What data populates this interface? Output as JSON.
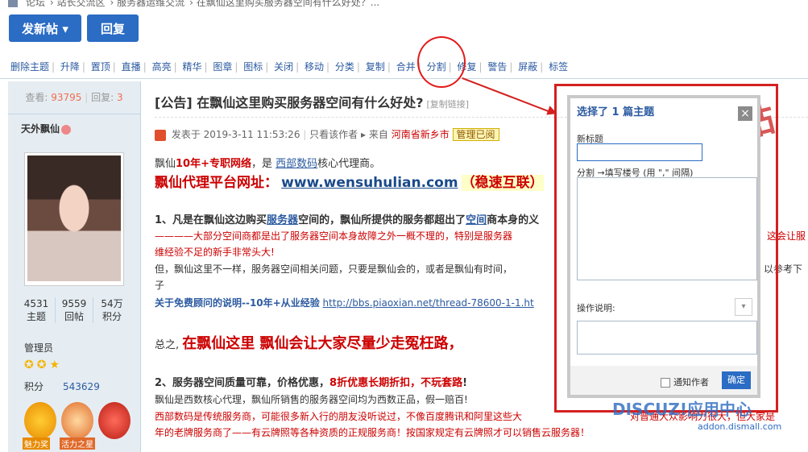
{
  "breadcrumb": [
    "论坛",
    "站长交流区",
    "服务器运维交流",
    "在飘仙这里购买服务器空间有什么好处？..."
  ],
  "buttons": {
    "new_post": "发新帖 ▾",
    "reply": "回复"
  },
  "mod_bar": [
    "删除主题",
    "升降",
    "置顶",
    "直播",
    "高亮",
    "精华",
    "图章",
    "图标",
    "关闭",
    "移动",
    "分类",
    "复制",
    "合并",
    "分割",
    "修复",
    "警告",
    "屏蔽",
    "标签"
  ],
  "sidebar": {
    "views_label": "查看:",
    "views": "93795",
    "replies_label": "回复:",
    "replies": "3",
    "author": "天外飘仙",
    "stats": [
      {
        "value": "4531",
        "label": "主题"
      },
      {
        "value": "9559",
        "label": "回帖"
      },
      {
        "value": "54万",
        "label": "积分"
      }
    ],
    "group": "管理员",
    "points_label": "积分",
    "points": "543629",
    "medals": [
      "魅力奖",
      "活力之星",
      ""
    ]
  },
  "post": {
    "title": "[公告] 在飘仙这里购买服务器空间有什么好处?",
    "copy_link": "[复制链接]",
    "meta_posted": "发表于 2019-3-11 11:53:26",
    "meta_author_only": "只看该作者",
    "meta_from": "来自",
    "meta_location": "河南省新乡市",
    "meta_badge": "管理已阅",
    "line1_a": "飘仙",
    "line1_b": "10年+专职网络",
    "line1_c": "，是",
    "line1_link": "西部数码",
    "line1_d": "核心代理商。",
    "line2_a": "飘仙代理平台网址：",
    "line2_link": "www.wensuhulian.com",
    "line2_b": "（稳速互联）",
    "line3_a": "1、凡是在飘仙这边购买",
    "line3_link1": "服务器",
    "line3_b": "空间的，飘仙所提供的服务都超出了",
    "line3_link2": "空间",
    "line3_c": "商本身的义",
    "line4": "————大部分空间商都是出了服务器空间本身故障之外一概不理的，特别是服务器",
    "line4_tail": "这会让服",
    "line5": "维经验不足的新手非常头大!",
    "line6": "但，飘仙这里不一样，服务器空间相关问题，只要是飘仙会的，或者是飘仙有时间，",
    "line6_tail": "以参考下",
    "line7": "子",
    "line8_a": "关于免费顾问的说明--10年+从业经验",
    "line8_link": "http://bbs.piaoxian.net/thread-78600-1-1.ht",
    "line9_a": "总之,",
    "line9_b": "在飘仙这里 飘仙会让大家尽量少走冤枉路，",
    "line10_a": "2、服务器空间质量可靠，价格优惠，",
    "line10_b": "8折优惠长期折扣，不玩套路",
    "line10_c": "!",
    "line11": "飘仙是西数核心代理，飘仙所销售的服务器空间均为西数正品，假一赔百!",
    "line12": "西部数码是传统服务商，可能很多新入行的朋友没听说过，不像百度腾讯和阿里这些大",
    "line12_tail": "对普通大众影响力很大，但大家是",
    "line13": "年的老牌服务商了——有云牌照等各种资质的正规服务商！按国家规定有云牌照才可以销售云服务器！"
  },
  "dialog": {
    "title": "选择了 1 篇主题",
    "close": "×",
    "new_title_label": "新标题",
    "split_label": "分割 →填写楼号 (用 \",\" 间隔)",
    "note_label": "操作说明:",
    "notify_label": "通知作者",
    "ok": "确定"
  },
  "stamp": "帖",
  "watermark": "DISCUZ!应用中心",
  "watermark_url": "addon.dismall.com",
  "colors": {
    "accent": "#2b6cc4",
    "highlight_red": "#d42020",
    "sidebar_bg": "#e5edf2"
  }
}
